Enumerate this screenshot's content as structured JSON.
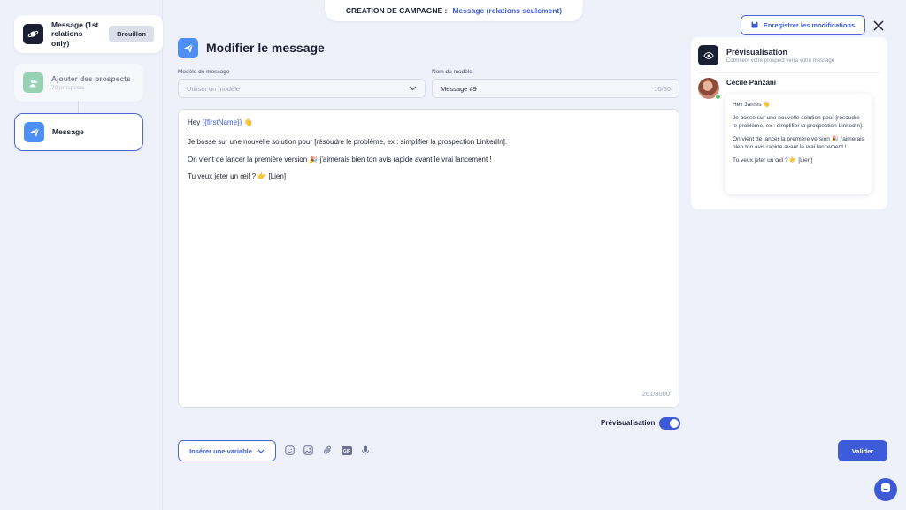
{
  "campaign_banner": {
    "label": "CREATION DE CAMPAGNE :",
    "value": "Message (relations seulement)"
  },
  "steps": [
    {
      "title": "Message (1st relations only)",
      "badge": "Brouillon"
    },
    {
      "title": "Ajouter des prospects",
      "subtitle": "70 prospects"
    },
    {
      "title": "Message"
    }
  ],
  "header": {
    "title": "Modifier le message"
  },
  "save_button": {
    "label": "Enregistrer les modifications"
  },
  "template_select": {
    "label": "Modèle de message",
    "placeholder": "Utiliser un modèle"
  },
  "template_name": {
    "label": "Nom du modèle",
    "value": "Message #9",
    "counter": "10/50"
  },
  "editor": {
    "greeting": "Hey",
    "variable": "{{firstName}}",
    "wave": "👋",
    "line1": "Je bosse sur une nouvelle solution pour [résoudre le problème, ex : simplifier la prospection LinkedIn].",
    "line2": "On vient de lancer la première version 🎉 j'aimerais bien ton avis rapide avant le vrai lancement !",
    "line3": "Tu veux jeter un œil ? 👉 [Lien]",
    "char_count": "261/8000"
  },
  "preview_toggle": {
    "label": "Prévisualisation",
    "on": true
  },
  "toolbar": {
    "insert_variable": "Insérer une variable",
    "validate": "Valider"
  },
  "preview": {
    "title": "Prévisualisation",
    "subtitle": "Comment votre prospect verra votre message",
    "contact_name": "Cécile Panzani",
    "message": {
      "greeting": "Hey James 👋",
      "line1": "Je bosse sur une nouvelle solution pour [résoudre le problème, ex : simplifier la prospection LinkedIn].",
      "line2": "On vient de lancer la première version 🎉 j'aimerais bien ton avis rapide avant le vrai lancement !",
      "line3": "Tu veux jeter un œil ? 👉 [Lien]"
    }
  },
  "colors": {
    "accent": "#3d5bd9",
    "background": "#eef0fa",
    "telegram_blue": "#4d8ff7",
    "prospect_green": "#4fb87a"
  }
}
